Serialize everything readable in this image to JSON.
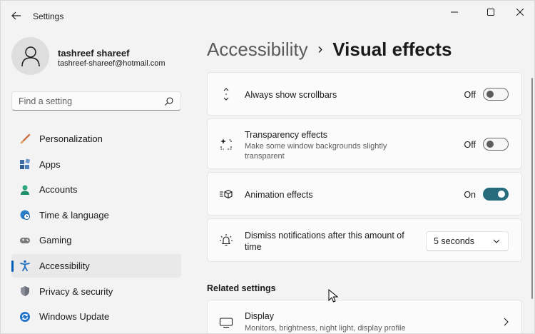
{
  "app": {
    "title": "Settings"
  },
  "window_controls": {
    "minimize_icon": "minimize-icon",
    "maximize_icon": "maximize-icon",
    "close_icon": "close-icon"
  },
  "profile": {
    "name": "tashreef shareef",
    "email": "tashreef-shareef@hotmail.com"
  },
  "search": {
    "placeholder": "Find a setting"
  },
  "sidebar": {
    "items": [
      {
        "label": "Personalization",
        "icon": "brush-icon",
        "active": false
      },
      {
        "label": "Apps",
        "icon": "apps-icon",
        "active": false
      },
      {
        "label": "Accounts",
        "icon": "person-icon",
        "active": false
      },
      {
        "label": "Time & language",
        "icon": "globe-clock-icon",
        "active": false
      },
      {
        "label": "Gaming",
        "icon": "gamepad-icon",
        "active": false
      },
      {
        "label": "Accessibility",
        "icon": "accessibility-icon",
        "active": true
      },
      {
        "label": "Privacy & security",
        "icon": "shield-icon",
        "active": false
      },
      {
        "label": "Windows Update",
        "icon": "update-icon",
        "active": false
      }
    ]
  },
  "breadcrumb": {
    "parent": "Accessibility",
    "separator": "›",
    "current": "Visual effects"
  },
  "settings": {
    "scrollbars": {
      "title": "Always show scrollbars",
      "state": "Off"
    },
    "transparency": {
      "title": "Transparency effects",
      "description": "Make some window backgrounds slightly transparent",
      "state": "Off"
    },
    "animation": {
      "title": "Animation effects",
      "state": "On"
    },
    "notifications": {
      "title": "Dismiss notifications after this amount of time",
      "value": "5 seconds"
    }
  },
  "related": {
    "heading": "Related settings",
    "display": {
      "title": "Display",
      "description": "Monitors, brightness, night light, display profile"
    }
  },
  "colors": {
    "accent": "#005fb8",
    "toggle_on": "#276b7c",
    "background": "#f3f3f3",
    "card": "#fbfbfb"
  }
}
